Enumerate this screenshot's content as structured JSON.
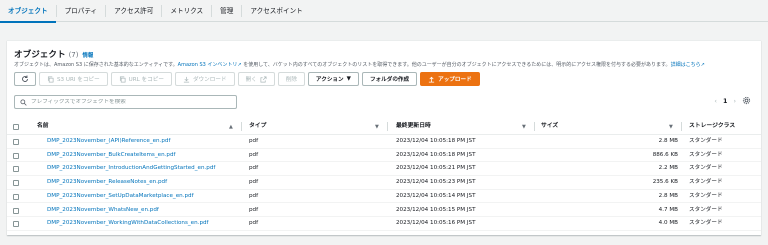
{
  "tabs": [
    {
      "label": "オブジェクト",
      "active": true
    },
    {
      "label": "プロパティ"
    },
    {
      "label": "アクセス許可"
    },
    {
      "label": "メトリクス"
    },
    {
      "label": "管理"
    },
    {
      "label": "アクセスポイント"
    }
  ],
  "panel": {
    "title": "オブジェクト",
    "count": "(7)",
    "info": "情報",
    "desc_pre": "オブジェクトは、Amazon S3 に保存された基本的なエンティティです。",
    "desc_link1": "Amazon S3 インベントリ",
    "desc_mid": " を使用して、バケット内のすべてのオブジェクトのリストを取得できます。他のユーザーが自分のオブジェクトにアクセスできるためには、明示的にアクセス権限を付与する必要があります。",
    "desc_link2": "詳細はこちら"
  },
  "toolbar": {
    "refresh_icon": "refresh-icon",
    "copy_s3_uri": "S3 URI をコピー",
    "copy_url": "URL をコピー",
    "download": "ダウンロード",
    "open": "開く",
    "delete": "削除",
    "actions": "アクション",
    "create_folder": "フォルダの作成",
    "upload": "アップロード",
    "accent": "#ec7211"
  },
  "search": {
    "placeholder": "プレフィックスでオブジェクトを検索"
  },
  "pagination": {
    "page": "1",
    "prev": "‹",
    "next": "›",
    "settings_icon": "gear-icon"
  },
  "table": {
    "headers": {
      "name": "名前",
      "type": "タイプ",
      "modified": "最終更新日時",
      "size": "サイズ",
      "storage": "ストレージクラス"
    },
    "rows": [
      {
        "name": "DMP_2023November_(API)Reference_en.pdf",
        "type": "pdf",
        "modified": "2023/12/04 10:05:18 PM JST",
        "size": "2.8 MB",
        "storage": "スタンダード"
      },
      {
        "name": "DMP_2023November_BulkCreateItems_en.pdf",
        "type": "pdf",
        "modified": "2023/12/04 10:05:18 PM JST",
        "size": "886.6 KB",
        "storage": "スタンダード"
      },
      {
        "name": "DMP_2023November_IntroductionAndGettingStarted_en.pdf",
        "type": "pdf",
        "modified": "2023/12/04 10:05:21 PM JST",
        "size": "2.2 MB",
        "storage": "スタンダード"
      },
      {
        "name": "DMP_2023November_ReleaseNotes_en.pdf",
        "type": "pdf",
        "modified": "2023/12/04 10:05:23 PM JST",
        "size": "235.6 KB",
        "storage": "スタンダード"
      },
      {
        "name": "DMP_2023November_SetUpDataMarketplace_en.pdf",
        "type": "pdf",
        "modified": "2023/12/04 10:05:14 PM JST",
        "size": "2.8 MB",
        "storage": "スタンダード"
      },
      {
        "name": "DMP_2023November_WhatsNew_en.pdf",
        "type": "pdf",
        "modified": "2023/12/04 10:05:15 PM JST",
        "size": "4.7 MB",
        "storage": "スタンダード"
      },
      {
        "name": "DMP_2023November_WorkingWithDataCollections_en.pdf",
        "type": "pdf",
        "modified": "2023/12/04 10:05:16 PM JST",
        "size": "4.0 MB",
        "storage": "スタンダード"
      }
    ]
  }
}
